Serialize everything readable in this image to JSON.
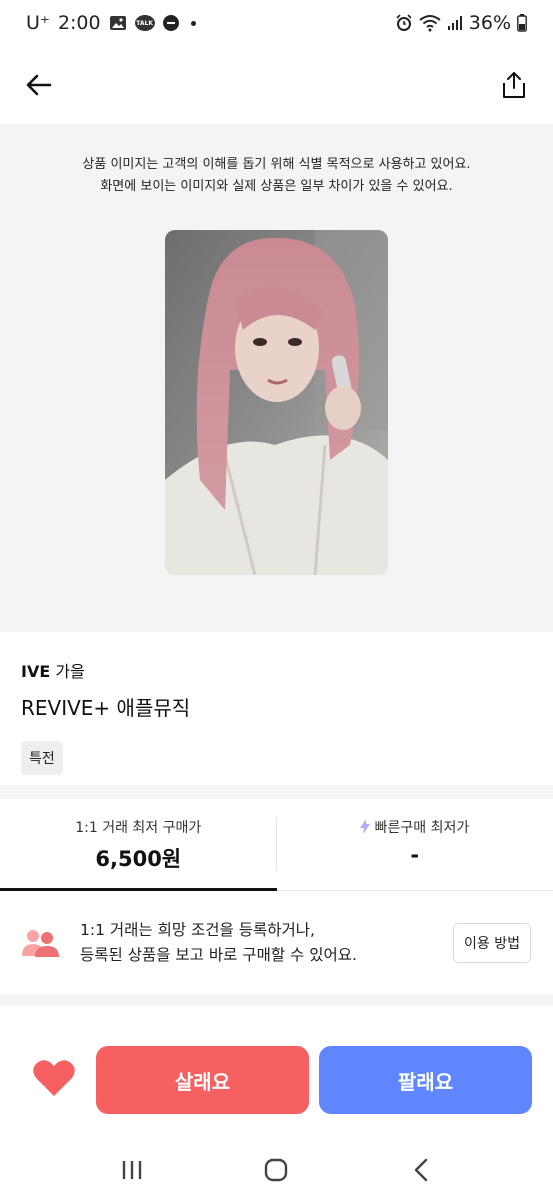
{
  "status_bar": {
    "carrier": "U⁺",
    "time": "2:00",
    "talk_badge": "TALK",
    "battery": "36%",
    "icons": [
      "gallery-icon",
      "talk-icon",
      "dnd-icon",
      "alarm-icon",
      "wifi-icon",
      "signal-icon",
      "battery-icon"
    ]
  },
  "header": {
    "back_icon": "arrow-left-icon",
    "share_icon": "share-icon"
  },
  "notice": {
    "line1": "상품 이미지는 고객의 이해를 돕기 위해 식별 목적으로 사용하고 있어요.",
    "line2": "화면에 보이는 이미지와 실제 상품은 일부 차이가 있을 수 있어요."
  },
  "product": {
    "artist_group": "IVE",
    "member": "가을",
    "title": "REVIVE+ 애플뮤직",
    "tag": "특전"
  },
  "tabs": [
    {
      "label": "1:1 거래 최저 구매가",
      "value": "6,500원",
      "active": true
    },
    {
      "label": "빠른구매 최저가",
      "value": "-",
      "active": false
    }
  ],
  "info": {
    "line1": "1:1 거래는 희망 조건을 등록하거나,",
    "line2": "등록된 상품을 보고 바로 구매할 수 있어요.",
    "button": "이용 방법"
  },
  "actions": {
    "buy": "살래요",
    "sell": "팔래요"
  },
  "colors": {
    "buy": "#f76060",
    "sell": "#5f86ff",
    "heart": "#f76060",
    "users_icon": "#f08080",
    "bolt": "#b9a8f5"
  }
}
